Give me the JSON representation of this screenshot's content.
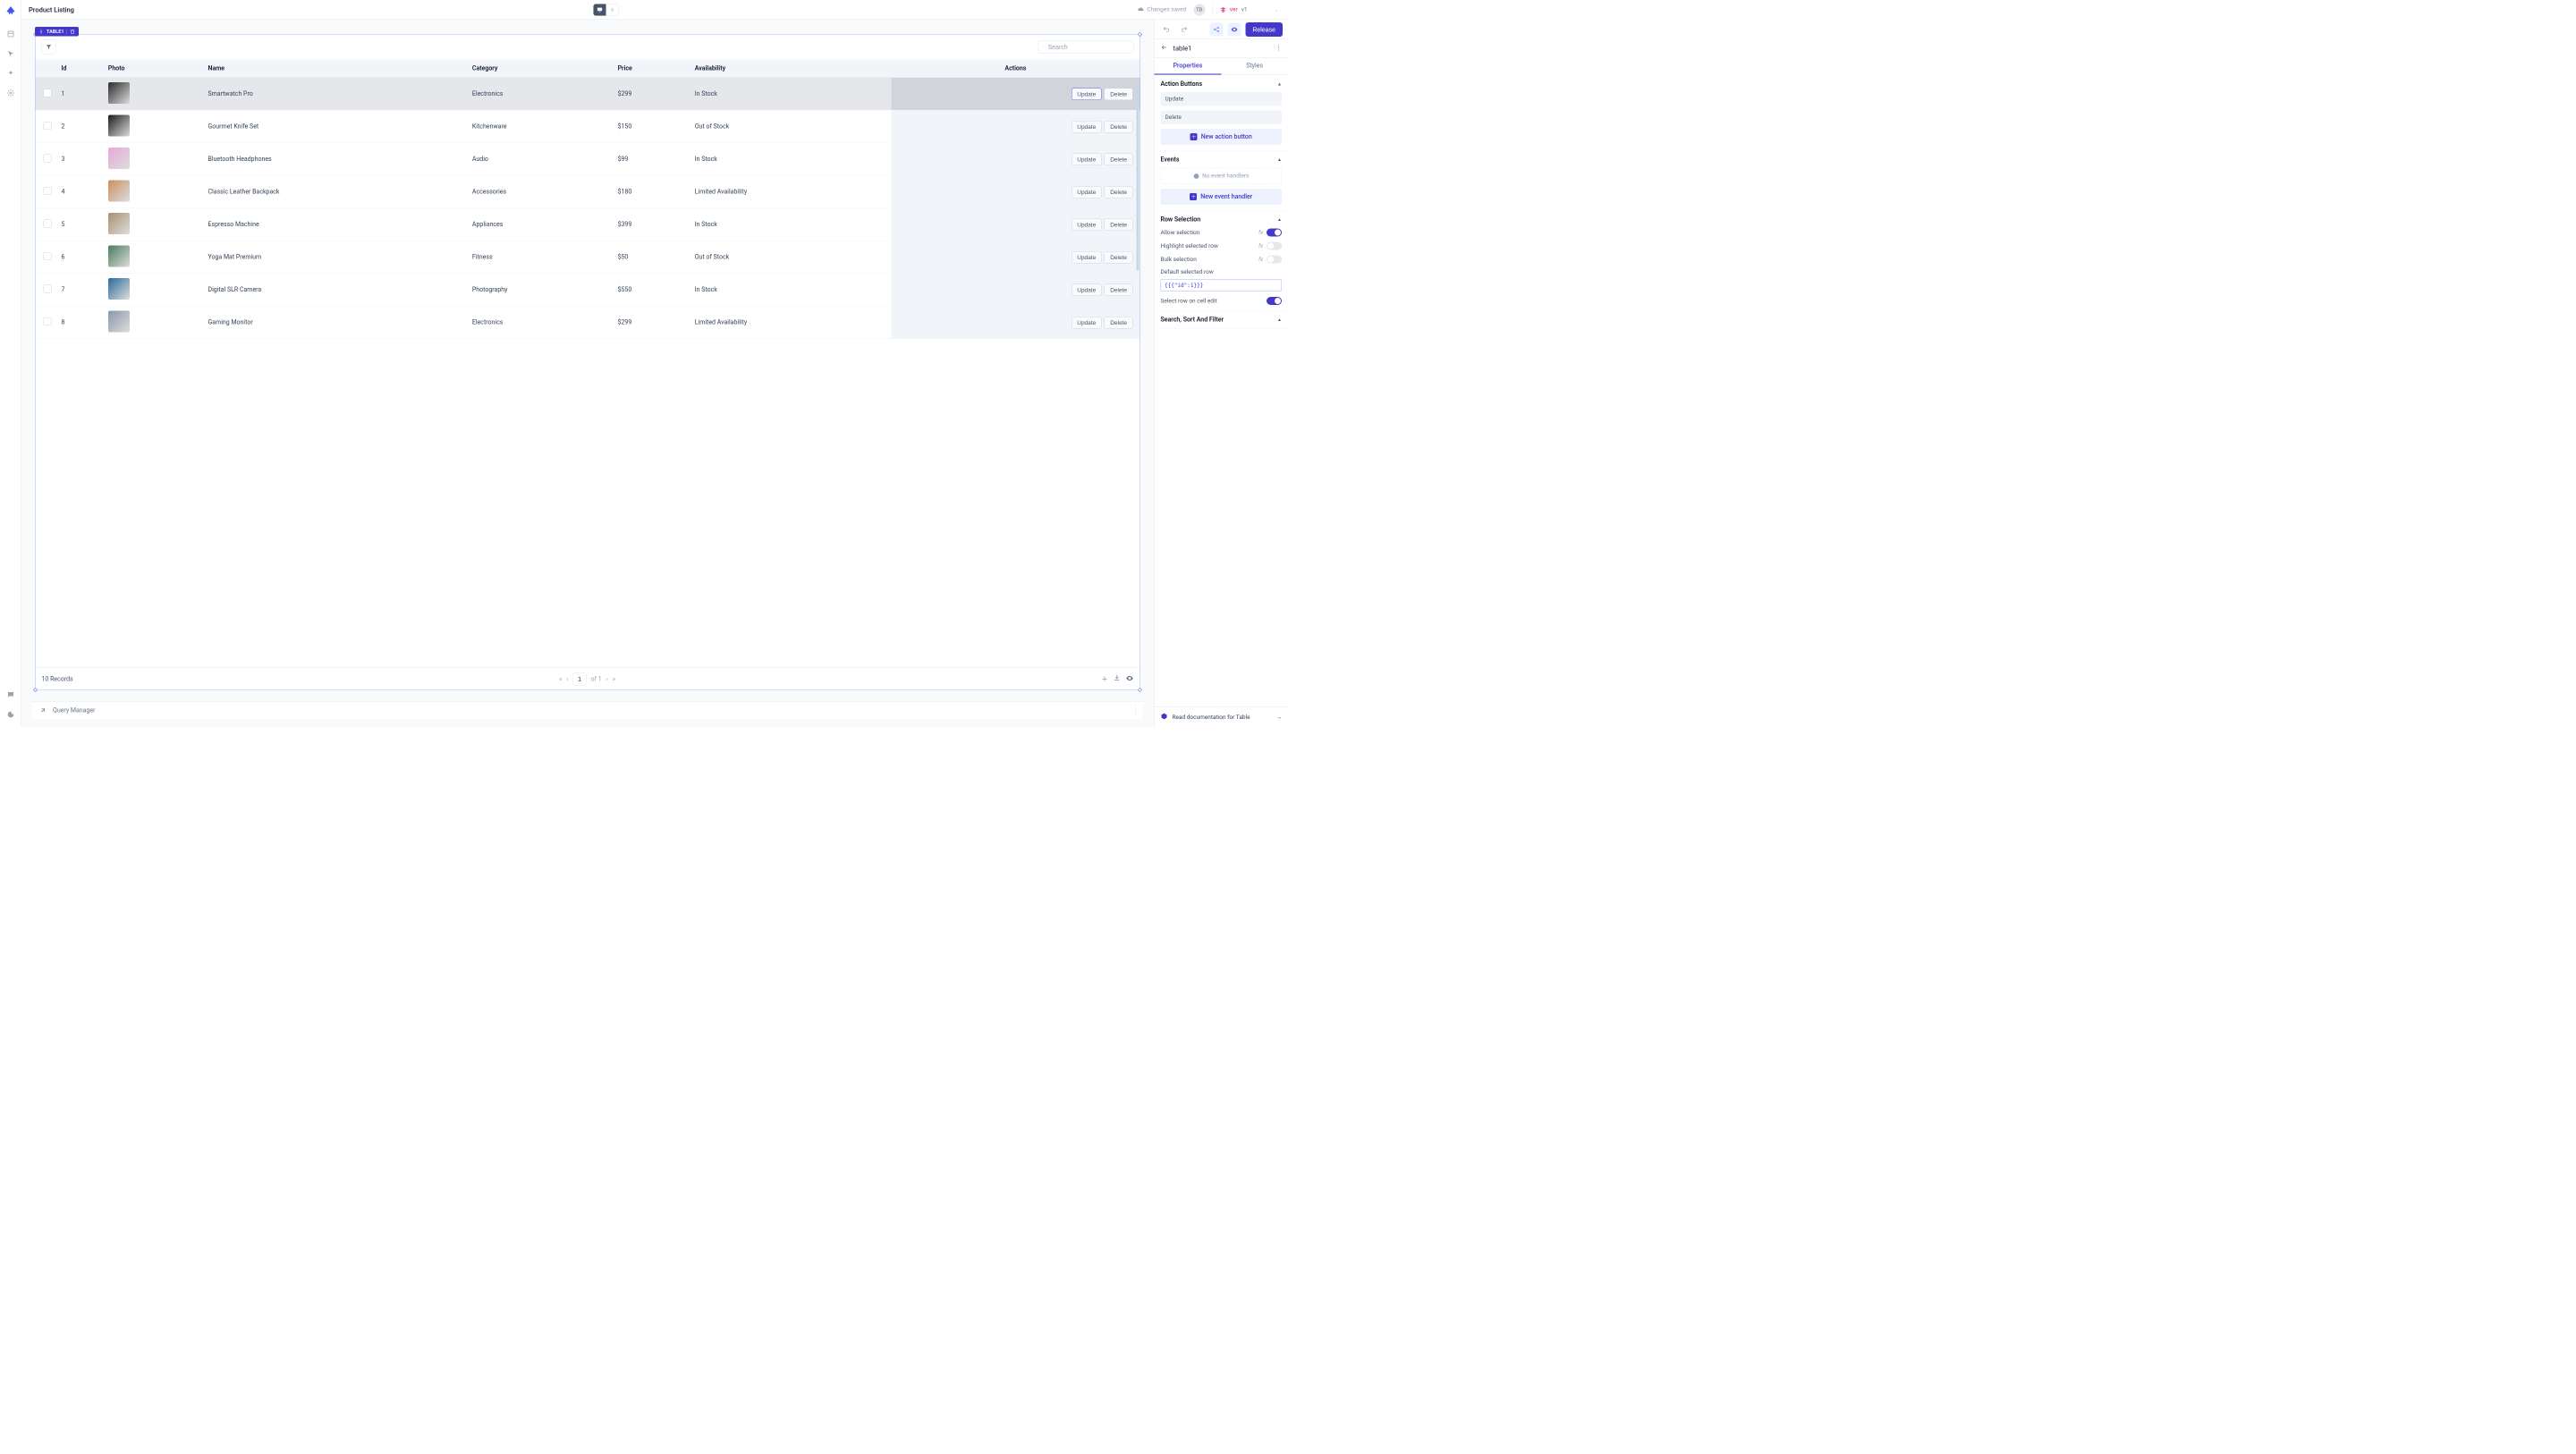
{
  "pageTitle": "Product Listing",
  "changesSaved": "Changes saved",
  "avatar": "TD",
  "versionLabel": "ver",
  "versionValue": "v1",
  "releaseLabel": "Release",
  "widgetBadge": "TABLE1",
  "searchPlaceholder": "Search",
  "columns": [
    "Id",
    "Photo",
    "Name",
    "Category",
    "Price",
    "Availability",
    "Actions"
  ],
  "rowButtons": {
    "update": "Update",
    "delete": "Delete"
  },
  "rows": [
    {
      "id": "1",
      "name": "Smartwatch Pro",
      "category": "Electronics",
      "price": "$299",
      "availability": "In Stock",
      "photoColor": "#2b2b2b"
    },
    {
      "id": "2",
      "name": "Gourmet Knife Set",
      "category": "Kitchenware",
      "price": "$150",
      "availability": "Out of Stock",
      "photoColor": "#1a1a1a"
    },
    {
      "id": "3",
      "name": "Bluetooth Headphones",
      "category": "Audio",
      "price": "$99",
      "availability": "In Stock",
      "photoColor": "#e8a8d8"
    },
    {
      "id": "4",
      "name": "Classic Leather Backpack",
      "category": "Accessories",
      "price": "$180",
      "availability": "Limited Availability",
      "photoColor": "#c89060"
    },
    {
      "id": "5",
      "name": "Espresso Machine",
      "category": "Appliances",
      "price": "$399",
      "availability": "In Stock",
      "photoColor": "#a89070"
    },
    {
      "id": "6",
      "name": "Yoga Mat Premium",
      "category": "Fitness",
      "price": "$50",
      "availability": "Out of Stock",
      "photoColor": "#4a7c59"
    },
    {
      "id": "7",
      "name": "Digital SLR Camera",
      "category": "Photography",
      "price": "$550",
      "availability": "In Stock",
      "photoColor": "#2a6a9a"
    },
    {
      "id": "8",
      "name": "Gaming Monitor",
      "category": "Electronics",
      "price": "$299",
      "availability": "Limited Availability",
      "photoColor": "#8898a8"
    }
  ],
  "footer": {
    "records": "10 Records",
    "pageNum": "1",
    "ofLabel": "of 1"
  },
  "queryManager": "Query Manager",
  "inspector": {
    "title": "table1",
    "tabs": {
      "properties": "Properties",
      "styles": "Styles"
    },
    "sections": {
      "actionButtons": {
        "title": "Action Buttons",
        "items": [
          "Update",
          "Delete"
        ],
        "newButton": "New action button"
      },
      "events": {
        "title": "Events",
        "empty": "No event handlers",
        "newHandler": "New event handler"
      },
      "rowSelection": {
        "title": "Row Selection",
        "allowSelection": "Allow selection",
        "highlightRow": "Highlight selected row",
        "bulkSelection": "Bulk selection",
        "defaultRow": "Default selected row",
        "defaultRowValue": "{{{\"id\":1}}}",
        "selectOnEdit": "Select row on cell edit"
      },
      "searchSort": {
        "title": "Search, Sort And Filter"
      }
    },
    "docLink": "Read documentation for Table"
  }
}
